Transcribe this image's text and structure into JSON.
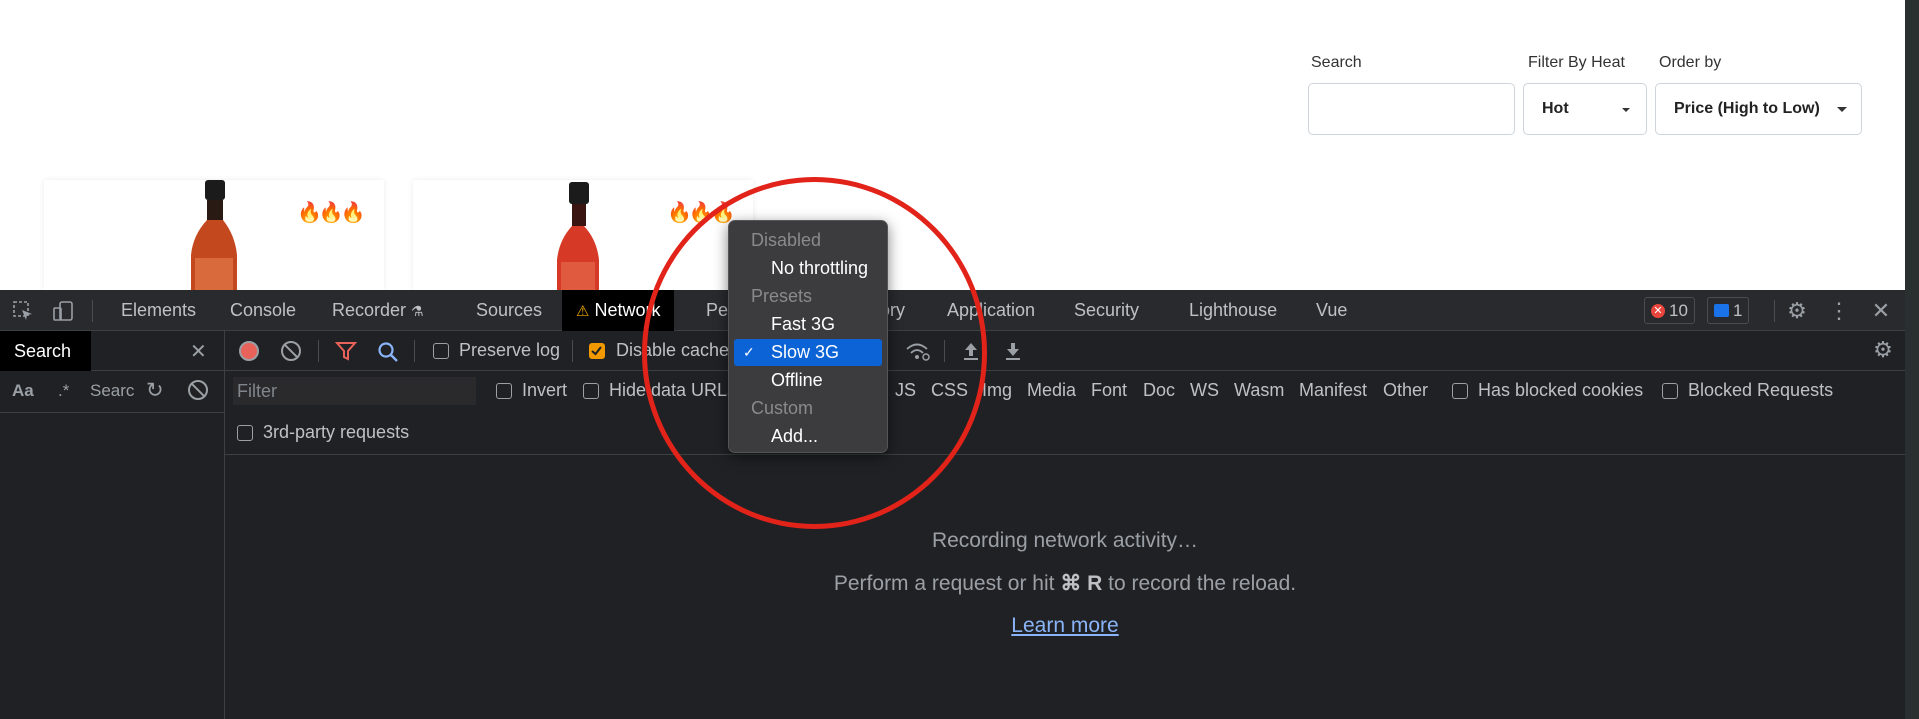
{
  "store": {
    "search_label": "Search",
    "search_value": "",
    "heat_label": "Filter By Heat",
    "heat_value": "Hot",
    "order_label": "Order by",
    "order_value": "Price (High to Low)",
    "products": [
      {
        "flames": "🔥🔥🔥"
      },
      {
        "flames": "🔥🔥🔥"
      }
    ]
  },
  "devtools": {
    "tabs": [
      "Elements",
      "Console",
      "Recorder",
      "Sources",
      "Network",
      "Pe",
      "ory",
      "Application",
      "Security",
      "Lighthouse",
      "Vue"
    ],
    "active_tab": "Network",
    "error_count": "10",
    "message_count": "1",
    "sidebar": {
      "title": "Search",
      "case_toggle": "Aa",
      "regex_toggle": ".*",
      "search_placeholder": "Search"
    },
    "toolbar": {
      "preserve_log": "Preserve log",
      "disable_cache": "Disable cache"
    },
    "filter": {
      "placeholder": "Filter",
      "invert": "Invert",
      "hide_data_urls": "Hide data URLs",
      "types": [
        "JS",
        "CSS",
        "Img",
        "Media",
        "Font",
        "Doc",
        "WS",
        "Wasm",
        "Manifest",
        "Other"
      ],
      "has_blocked_cookies": "Has blocked cookies",
      "blocked_requests": "Blocked Requests",
      "third_party": "3rd-party requests"
    },
    "empty": {
      "line1": "Recording network activity…",
      "line2_pre": "Perform a request or hit",
      "shortcut": "⌘ R",
      "line2_post": "to record the reload.",
      "learn_more": "Learn more"
    },
    "throttle_menu": {
      "disabled_header": "Disabled",
      "no_throttling": "No throttling",
      "presets_header": "Presets",
      "fast3g": "Fast 3G",
      "slow3g": "Slow 3G",
      "offline": "Offline",
      "custom_header": "Custom",
      "add": "Add...",
      "selected": "Slow 3G"
    }
  },
  "colors": {
    "highlight_circle": "#e2231a",
    "selection": "#0b63d6",
    "record": "#e8625a"
  }
}
